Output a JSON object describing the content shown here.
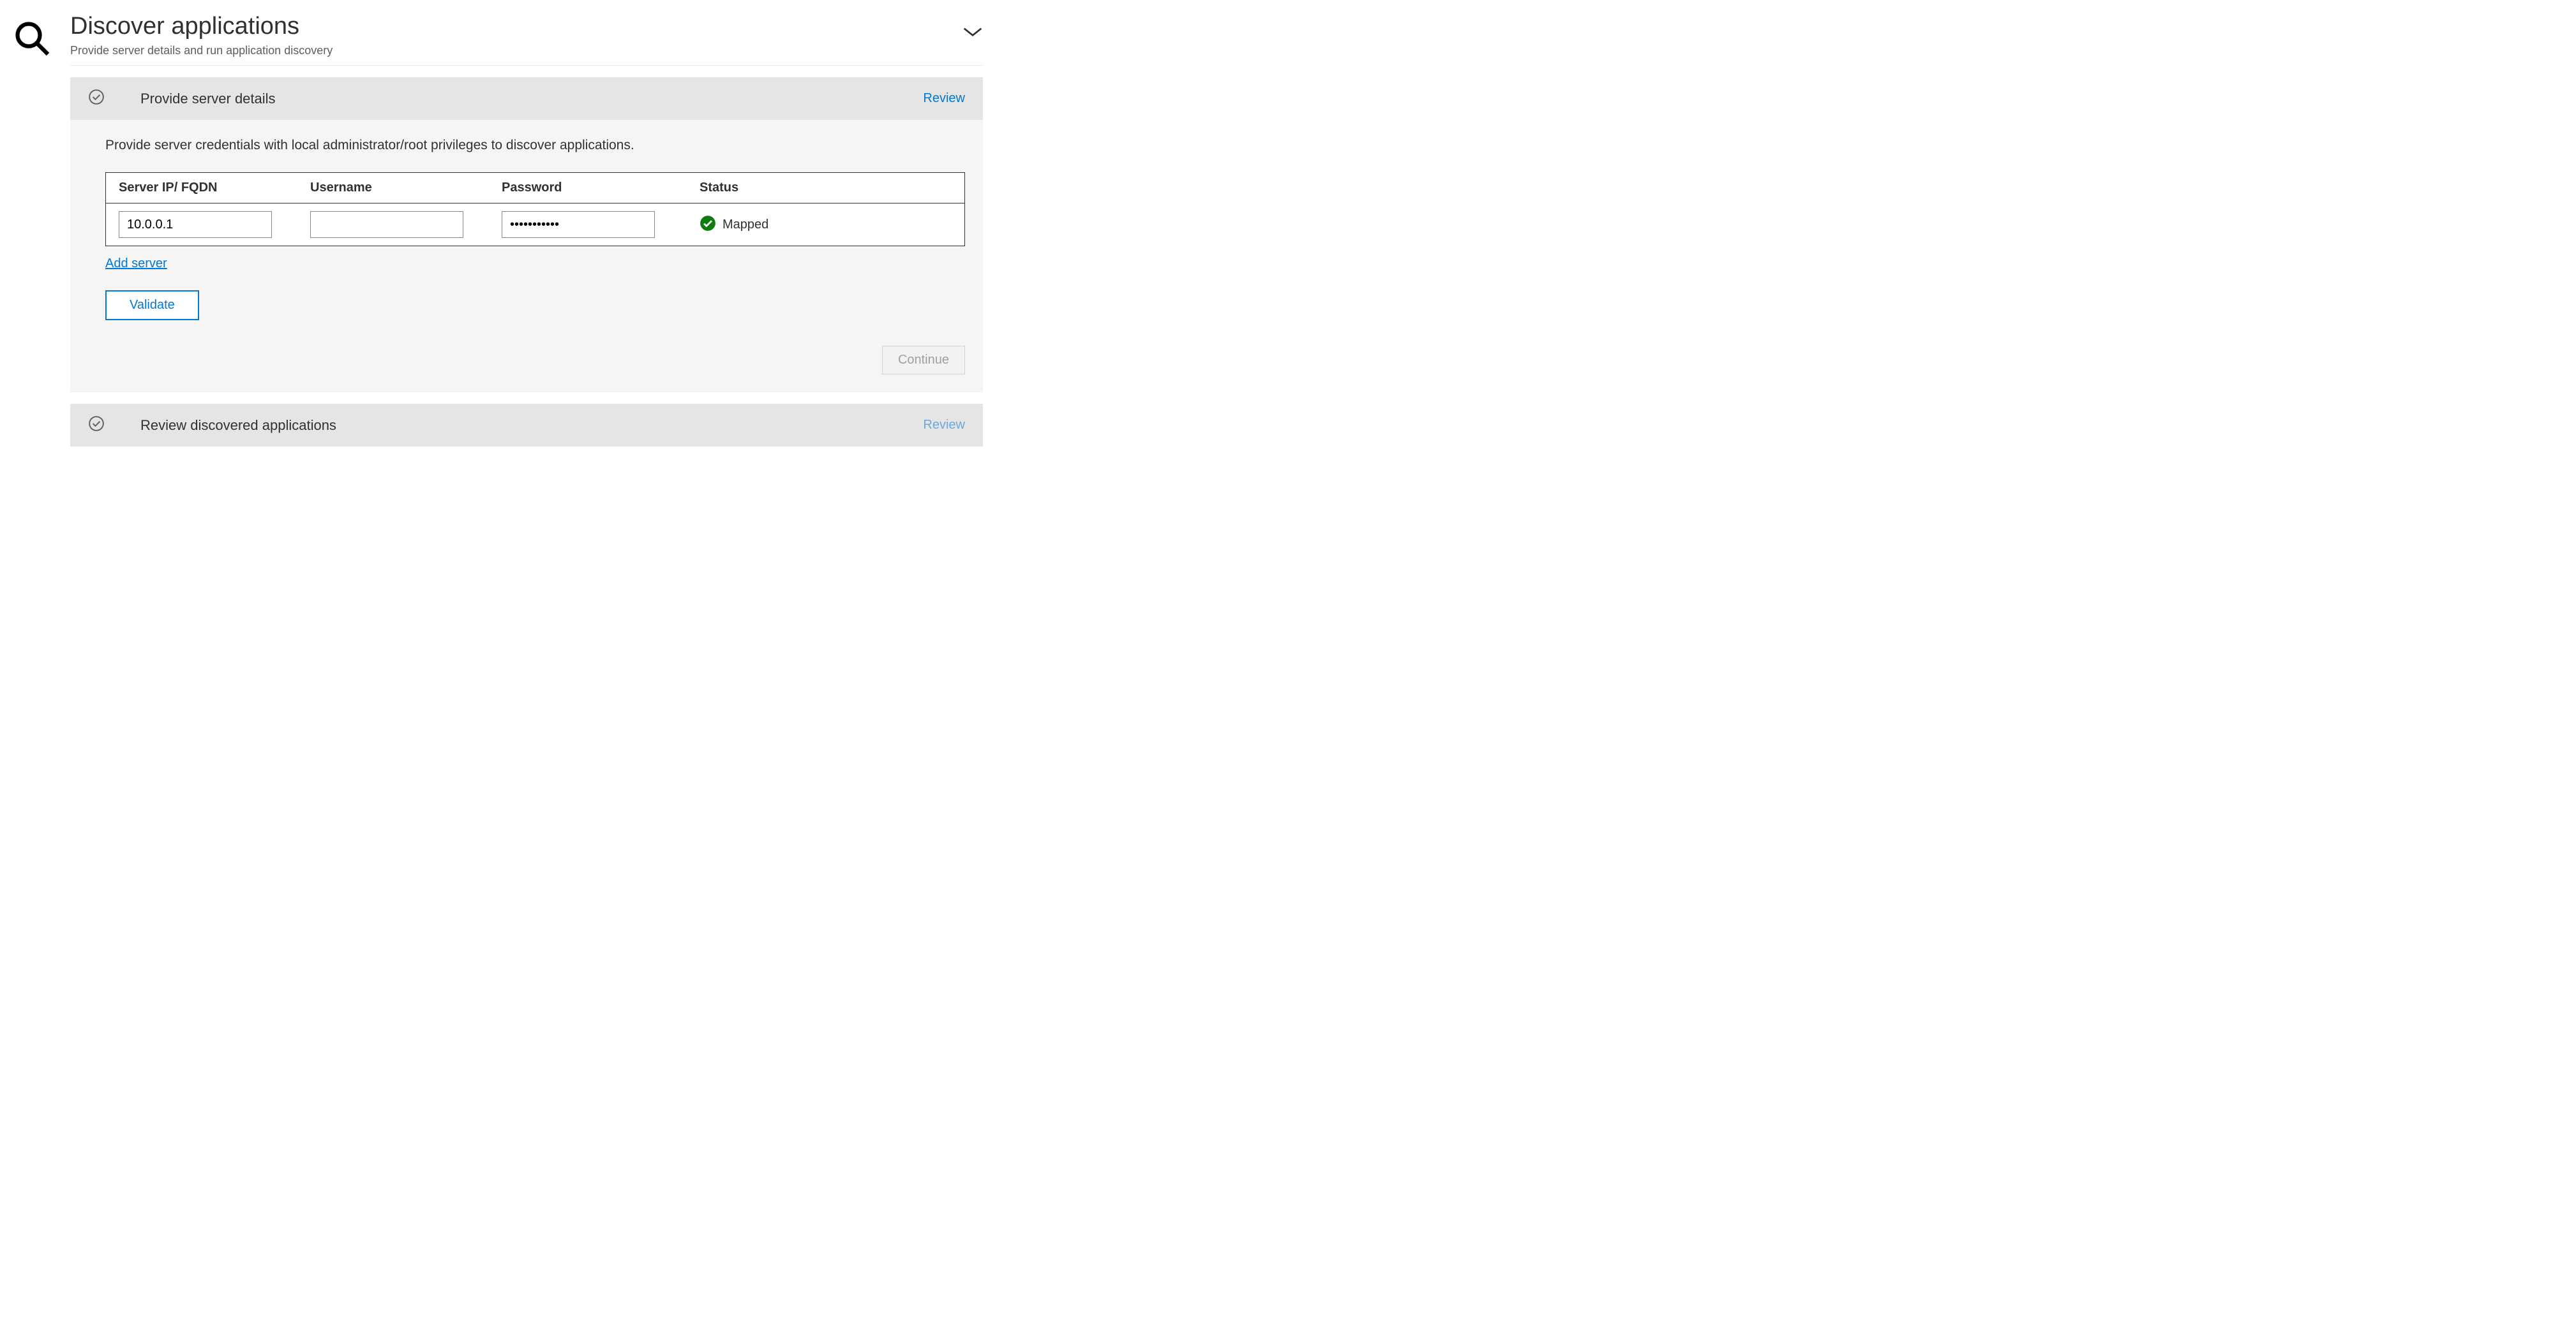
{
  "header": {
    "title": "Discover applications",
    "subtitle": "Provide server details and run application discovery"
  },
  "section1": {
    "title": "Provide server details",
    "review_label": "Review",
    "description": "Provide server credentials with local administrator/root privileges to discover applications.",
    "table": {
      "headers": {
        "server": "Server IP/ FQDN",
        "username": "Username",
        "password": "Password",
        "status": "Status"
      },
      "row": {
        "server_value": "10.0.0.1",
        "username_value": "",
        "password_value": "•••••••••••",
        "status_text": "Mapped"
      }
    },
    "add_server_label": "Add server",
    "validate_label": "Validate",
    "continue_label": "Continue"
  },
  "section2": {
    "title": "Review discovered applications",
    "review_label": "Review"
  },
  "colors": {
    "link": "#0078d4",
    "success": "#107c10",
    "border": "#323130"
  }
}
